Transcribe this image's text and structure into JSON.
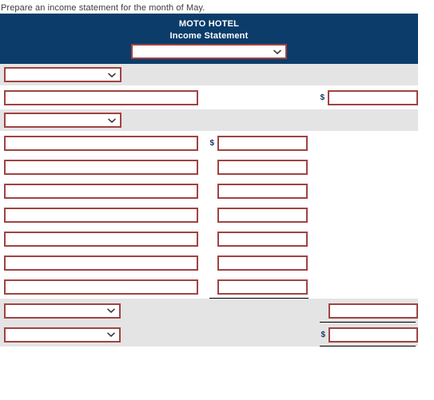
{
  "instruction": "Prepare an income statement for the month of May.",
  "worksheet": {
    "company_name": "MOTO HOTEL",
    "statement_title": "Income Statement",
    "header_period_select": {
      "value": "",
      "icon": "chevron-down-icon"
    },
    "colors": {
      "header_background": "#0b3c6a",
      "header_text": "#ffffff",
      "input_border": "#a04342",
      "row_shaded": "#e4e4e4",
      "row_plain": "#ffffff",
      "dollar_sign": "#1b3a66",
      "rule": "#000000"
    },
    "section_revenue": {
      "heading_select": {
        "value": "",
        "icon": "chevron-down-icon"
      },
      "line": {
        "label_value": "",
        "currency_symbol": "$",
        "amount_value": ""
      }
    },
    "section_expenses": {
      "heading_select": {
        "value": "",
        "icon": "chevron-down-icon"
      },
      "lines": [
        {
          "label_value": "",
          "currency_symbol": "$",
          "amount_value": "",
          "show_currency": true,
          "show_rule": false
        },
        {
          "label_value": "",
          "currency_symbol": "",
          "amount_value": "",
          "show_currency": false,
          "show_rule": false
        },
        {
          "label_value": "",
          "currency_symbol": "",
          "amount_value": "",
          "show_currency": false,
          "show_rule": false
        },
        {
          "label_value": "",
          "currency_symbol": "",
          "amount_value": "",
          "show_currency": false,
          "show_rule": false
        },
        {
          "label_value": "",
          "currency_symbol": "",
          "amount_value": "",
          "show_currency": false,
          "show_rule": false
        },
        {
          "label_value": "",
          "currency_symbol": "",
          "amount_value": "",
          "show_currency": false,
          "show_rule": false
        },
        {
          "label_value": "",
          "currency_symbol": "",
          "amount_value": "",
          "show_currency": false,
          "show_rule": true
        }
      ]
    },
    "section_totals": {
      "lines": [
        {
          "select_value": "",
          "icon": "chevron-down-icon",
          "currency_symbol": "",
          "amount_value": "",
          "show_currency": false,
          "show_rule": true
        },
        {
          "select_value": "",
          "icon": "chevron-down-icon",
          "currency_symbol": "$",
          "amount_value": "",
          "show_currency": true,
          "show_rule": true
        }
      ]
    }
  }
}
